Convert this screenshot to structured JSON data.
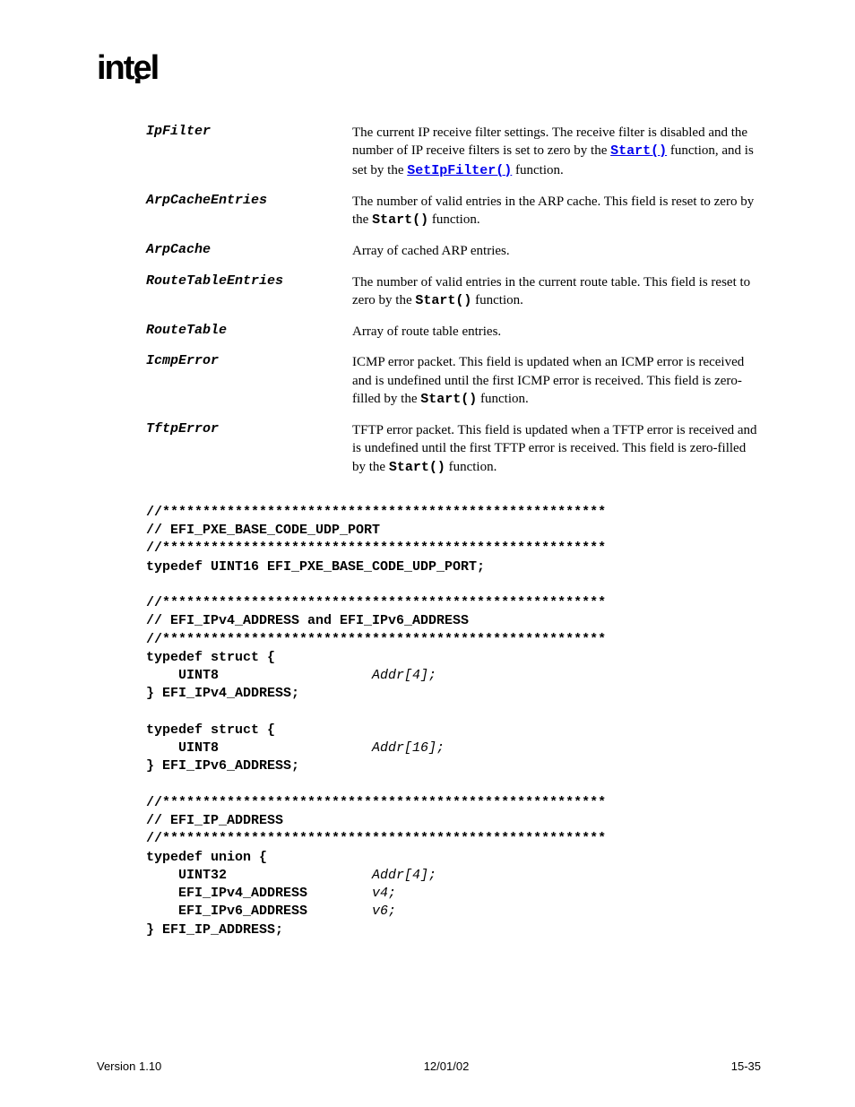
{
  "logo": "intel",
  "definitions": [
    {
      "term": "IpFilter",
      "desc_html": "The current IP receive filter settings.  The receive filter is disabled and the number of IP receive filters is set to zero by the <span class='code-link'>Start()</span> function, and is set by the <span class='code-link'>SetIpFilter()</span> function."
    },
    {
      "term": "ArpCacheEntries",
      "desc_html": "The number of valid entries in the ARP cache.  This field is reset to zero by the <span class='code-inline'>Start()</span> function."
    },
    {
      "term": "ArpCache",
      "desc_html": "Array of cached ARP entries."
    },
    {
      "term": "RouteTableEntries",
      "desc_html": "The number of valid entries in the current route table.  This field is reset to zero by the <span class='code-inline'>Start()</span> function."
    },
    {
      "term": "RouteTable",
      "desc_html": "Array of route table entries."
    },
    {
      "term": "IcmpError",
      "desc_html": "ICMP error packet.  This field is updated when an ICMP error is received and is undefined until the first ICMP error is received.  This field is zero-filled by the <span class='code-inline'>Start()</span> function."
    },
    {
      "term": "TftpError",
      "desc_html": "TFTP error packet.  This field is updated when a TFTP error is received and is undefined until the first TFTP error is received.  This field is zero-filled by the <span class='code-inline'>Start()</span> function."
    }
  ],
  "code": {
    "sep": "//*******************************************************",
    "c1": "// EFI_PXE_BASE_CODE_UDP_PORT",
    "t1": "typedef UINT16 EFI_PXE_BASE_CODE_UDP_PORT;",
    "c2": "// EFI_IPv4_ADDRESS and EFI_IPv6_ADDRESS",
    "ts": "typedef struct {",
    "u8": "    UINT8",
    "a4": "Addr[4];",
    "e4": "} EFI_IPv4_ADDRESS;",
    "a16": "Addr[16];",
    "e6": "} EFI_IPv6_ADDRESS;",
    "c3": "// EFI_IP_ADDRESS",
    "tu": "typedef union {",
    "u32": "    UINT32",
    "ip4": "    EFI_IPv4_ADDRESS",
    "v4": "v4;",
    "ip6": "    EFI_IPv6_ADDRESS",
    "v6": "v6;",
    "eip": "} EFI_IP_ADDRESS;"
  },
  "footer": {
    "left": "Version 1.10",
    "center": "12/01/02",
    "right": "15-35"
  }
}
